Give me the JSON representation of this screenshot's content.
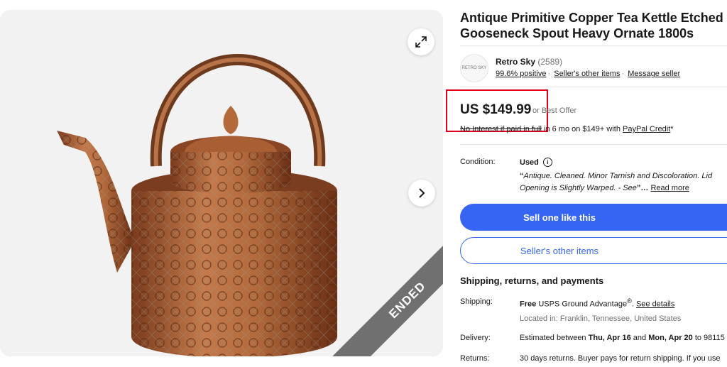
{
  "listing": {
    "title": "Antique Primitive Copper Tea Kettle Etched Gooseneck Spout Heavy Ornate 1800s",
    "status_ribbon": "ENDED"
  },
  "seller": {
    "name": "Retro Sky",
    "feedback_count": "(2589)",
    "positive": "99.6% positive",
    "other_items_link": "Seller's other items",
    "message_link": "Message seller",
    "logo_text": "RETRO SKY"
  },
  "price": {
    "amount": "US $149.99",
    "offer": "or Best Offer",
    "financing_strike": "No Interest if paid in full",
    "financing_rest": "in 6 mo on $149+ with",
    "paypal_link": "PayPal Credit",
    "asterisk": "*"
  },
  "condition": {
    "label": "Condition:",
    "value": "Used",
    "info_icon": "i",
    "desc_open": "“",
    "desc": "Antique. Cleaned. Minor Tarnish and Discoloration. Lid Opening is Slightly Warped. - See",
    "desc_close": "”…",
    "read_more": "Read more"
  },
  "buttons": {
    "sell_one": "Sell one like this",
    "sellers_other": "Seller's other items"
  },
  "shipping": {
    "section_title": "Shipping, returns, and payments",
    "shipping_label": "Shipping:",
    "shipping_free": "Free",
    "shipping_service": "USPS Ground Advantage",
    "shipping_reg": "®",
    "shipping_sep": ".",
    "see_details": "See details",
    "location": "Located in: Franklin, Tennessee, United States",
    "delivery_label": "Delivery:",
    "delivery_prefix": "Estimated between",
    "delivery_from": "Thu, Apr 16",
    "delivery_and": "and",
    "delivery_to": "Mon, Apr 20",
    "delivery_suffix": "to 98115",
    "returns_label": "Returns:",
    "returns_value": "30 days returns. Buyer pays for return shipping. If you use"
  },
  "colors": {
    "accent": "#3665f3",
    "highlight_box": "#e0001b",
    "ribbon": "#707070"
  },
  "icons": {
    "expand": "expand-icon",
    "next": "chevron-right-icon"
  }
}
